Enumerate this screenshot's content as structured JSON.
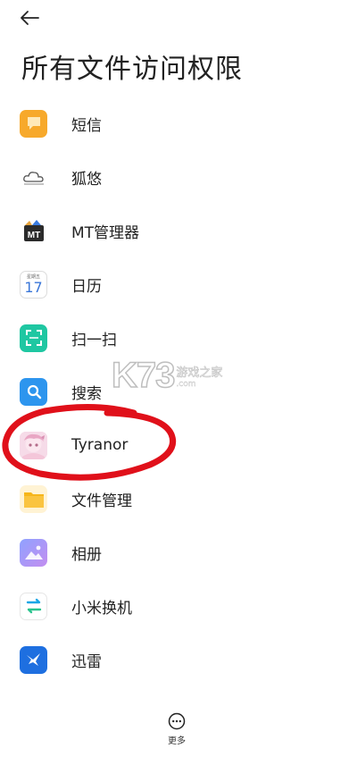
{
  "header": {
    "title": "所有文件访问权限"
  },
  "apps": [
    {
      "label": "短信",
      "icon": "messages-icon"
    },
    {
      "label": "狐悠",
      "icon": "cloud-icon"
    },
    {
      "label": "MT管理器",
      "icon": "mt-manager-icon"
    },
    {
      "label": "日历",
      "icon": "calendar-icon",
      "icon_day": "17",
      "icon_weekday": "星期五"
    },
    {
      "label": "扫一扫",
      "icon": "scanner-icon"
    },
    {
      "label": "搜索",
      "icon": "search-icon"
    },
    {
      "label": "Tyranor",
      "icon": "tyranor-avatar-icon"
    },
    {
      "label": "文件管理",
      "icon": "folder-icon"
    },
    {
      "label": "相册",
      "icon": "gallery-icon"
    },
    {
      "label": "小米换机",
      "icon": "mi-mover-icon"
    },
    {
      "label": "迅雷",
      "icon": "thunder-bird-icon"
    }
  ],
  "footer": {
    "more_label": "更多",
    "more_icon": "more-dots-icon"
  },
  "watermark": {
    "big": "K73",
    "cn": "游戏之家",
    "en": ".com"
  },
  "colors": {
    "messages": "#f7a92b",
    "scanner": "#1fc7a2",
    "search": "#2d95ee",
    "folder": "#f6b61b",
    "thunder": "#1e6fe0",
    "annotation": "#e0101a"
  }
}
